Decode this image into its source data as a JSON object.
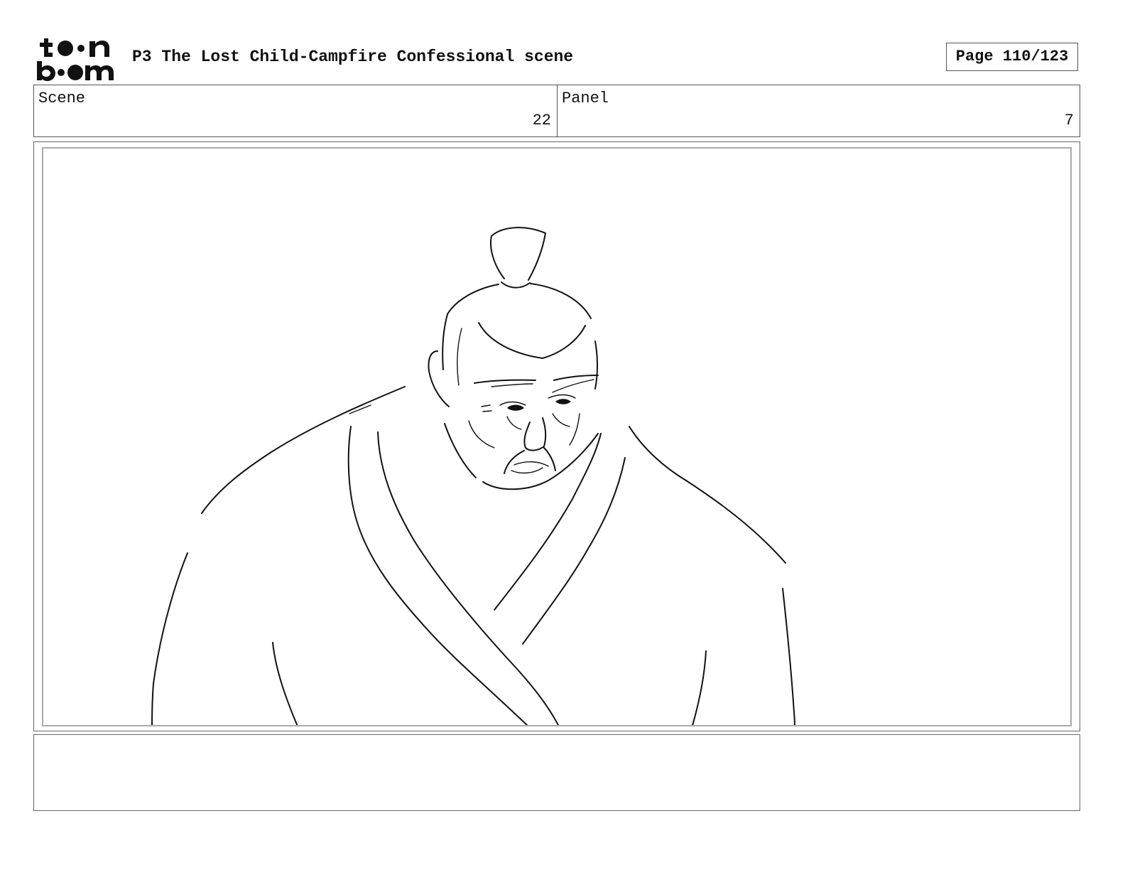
{
  "header": {
    "logo_name": "toon-boom-logo",
    "title": "P3 The Lost Child-Campfire Confessional scene",
    "page_counter": "Page 110/123"
  },
  "info": {
    "scene_label": "Scene",
    "scene_value": "22",
    "panel_label": "Panel",
    "panel_value": "7"
  },
  "caption": {
    "text": ""
  }
}
